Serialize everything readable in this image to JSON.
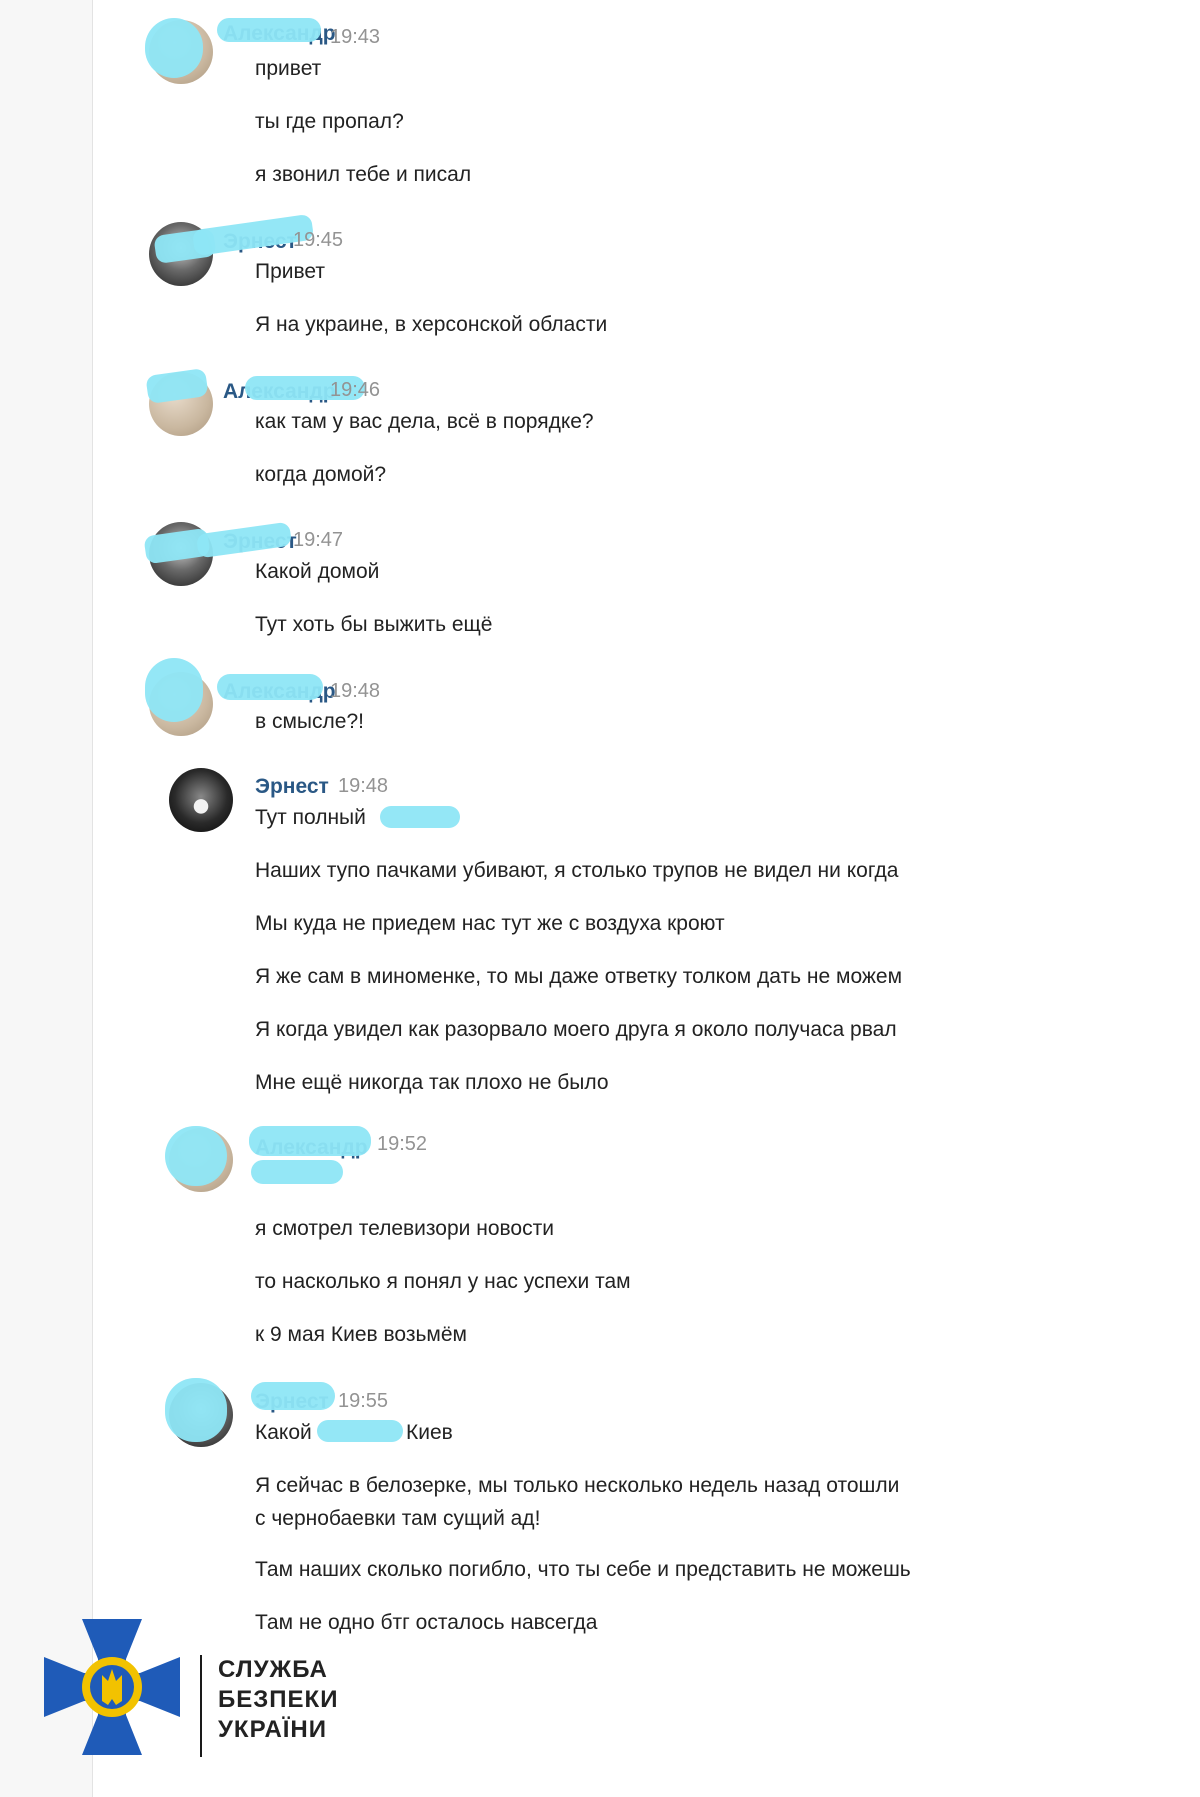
{
  "messages": [
    {
      "author": "Александр",
      "time": "19:43",
      "lines": [
        "привет",
        "ты где пропал?",
        "я звонил тебе и писал"
      ]
    },
    {
      "author": "Эрнест",
      "time": "19:45",
      "lines": [
        "Привет",
        "Я на украине, в херсонской области"
      ]
    },
    {
      "author": "Александр",
      "time": "19:46",
      "lines": [
        "как там у вас дела, всё в порядке?",
        "когда домой?"
      ]
    },
    {
      "author": "Эрнест",
      "time": "19:47",
      "lines": [
        "Какой домой",
        "Тут хоть бы выжить ещё"
      ]
    },
    {
      "author": "Александр",
      "time": "19:48",
      "lines": [
        "в смысле?!"
      ]
    },
    {
      "author": "Эрнест",
      "time": "19:48",
      "lines": [
        "Тут полный",
        "Наших тупо пачками убивают, я столько трупов не видел ни когда",
        "Мы куда не приедем нас тут же с воздуха кроют",
        "Я же сам в миноменке, то мы даже ответку толком дать не можем",
        "Я когда увидел как разорвало моего друга я около получаса рвал",
        "Мне ещё никогда так плохо не было"
      ]
    },
    {
      "author": "Александр",
      "time": "19:52",
      "lines": [
        "я смотрел телевизори новости",
        "то насколько я понял у нас успехи там",
        "к 9 мая Киев возьмём"
      ]
    },
    {
      "author": "Эрнест",
      "time": "19:55",
      "lines": [
        "Какой",
        "Киев",
        "Я сейчас в белозерке, мы только несколько недель назад отошли",
        "с чернобаевки там сущий ад!",
        "Там наших сколько погибло, что ты себе и представить не можешь",
        "Там не одно бтг осталось навсегда"
      ]
    }
  ],
  "org": {
    "line1": "СЛУЖБА",
    "line2": "БЕЗПЕКИ",
    "line3": "УКРАЇНИ"
  },
  "colors": {
    "name": "#2a5885",
    "time": "#939393",
    "redaction": "#8ee6f6",
    "logo_blue": "#1f5bb8",
    "logo_gold": "#f2c200"
  }
}
